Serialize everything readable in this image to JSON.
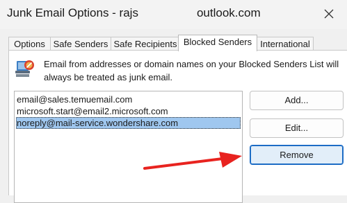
{
  "window": {
    "title_prefix": "Junk Email Options - rajs",
    "title_suffix": "outlook.com",
    "close_icon": "close-icon"
  },
  "tabs": [
    {
      "label": "Options",
      "active": false
    },
    {
      "label": "Safe Senders",
      "active": false
    },
    {
      "label": "Safe Recipients",
      "active": false
    },
    {
      "label": "Blocked Senders",
      "active": true
    },
    {
      "label": "International",
      "active": false
    }
  ],
  "blocked_senders": {
    "description": "Email from addresses or domain names on your Blocked Senders List will always be treated as junk email.",
    "icon": "blocked-senders-icon",
    "entries": [
      {
        "address": "email@sales.temuemail.com",
        "selected": false
      },
      {
        "address": "microsoft.start@email2.microsoft.com",
        "selected": false
      },
      {
        "address": "noreply@mail-service.wondershare.com",
        "selected": true
      }
    ],
    "buttons": {
      "add": "Add...",
      "edit": "Edit...",
      "remove": "Remove"
    }
  },
  "annotation": {
    "arrow_color": "#e8231f",
    "arrow_icon": "red-arrow-icon"
  }
}
